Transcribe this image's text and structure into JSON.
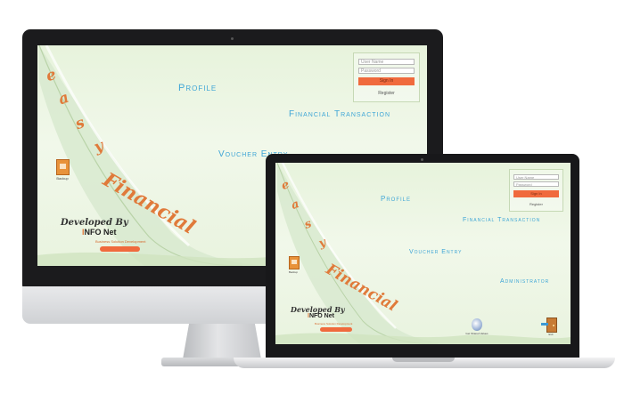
{
  "app": {
    "brand_letters": [
      "e",
      "a",
      "s",
      "y"
    ],
    "brand_word": "Financial",
    "developed_by": "Developed By",
    "company_prefix": "I",
    "company_rest": "NFO Net",
    "tagline": "Business Solution Development"
  },
  "menu": {
    "profile": "Profile",
    "financial_transaction": "Financial Transaction",
    "voucher_entry": "Voucher Entry",
    "administrator": "Administrator"
  },
  "login": {
    "username_placeholder": "User Name",
    "password_placeholder": "Password",
    "sign_in_label": "Sign In",
    "register_link": "Register"
  },
  "icons": {
    "backup_label": "Backup",
    "share_label": "Get Shared Values",
    "exit_label": "Exit"
  },
  "colors": {
    "accent": "#f06a3d",
    "menu_text": "#3fa6d6",
    "background": "#eaf4e0"
  }
}
